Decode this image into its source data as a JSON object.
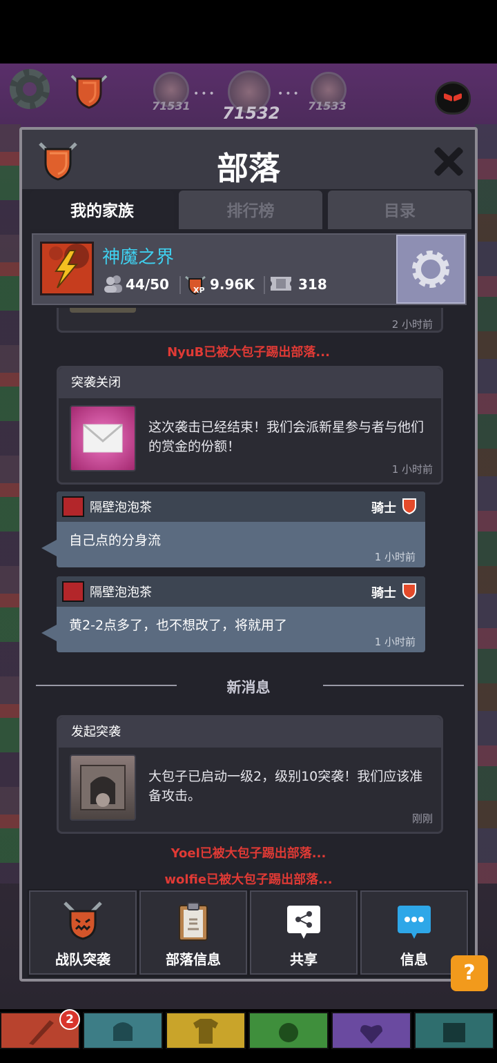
{
  "top_hud": {
    "stages": [
      "71531",
      "71532",
      "71533"
    ]
  },
  "panel": {
    "title": "部落",
    "tabs": [
      {
        "label": "我的家族",
        "active": true
      },
      {
        "label": "排行榜",
        "active": false
      },
      {
        "label": "目录",
        "active": false
      }
    ],
    "clan": {
      "name": "神魔之界",
      "members": "44/50",
      "xp": "9.96K",
      "tickets": "318",
      "xp_badge": "XP"
    }
  },
  "feed": {
    "prev_card_time": "2 小时前",
    "kick_1": "NyuB已被大包子踢出部落...",
    "raid_closed": {
      "title": "突袭关闭",
      "text": "这次袭击已经结束！我们会派新星参与者与他们的赏金的份额！",
      "time": "1 小时前"
    },
    "chat_1": {
      "user": "隔壁泡泡茶",
      "rank": "骑士",
      "message": "自己点的分身流",
      "time": "1 小时前"
    },
    "chat_2": {
      "user": "隔壁泡泡茶",
      "rank": "骑士",
      "message": "黄2-2点多了，也不想改了，将就用了",
      "time": "1 小时前"
    },
    "divider": "新消息",
    "raid_started": {
      "title": "发起突袭",
      "text": "大包子已启动一级2，级别10突袭！我们应该准备攻击。",
      "time": "刚刚"
    },
    "kick_2": "Yoel已被大包子踢出部落...",
    "kick_3": "wolfie已被大包子踢出部落..."
  },
  "bottom_buttons": [
    {
      "label": "战队突袭",
      "icon": "raid-mask-icon"
    },
    {
      "label": "部落信息",
      "icon": "clipboard-icon"
    },
    {
      "label": "共享",
      "icon": "share-icon"
    },
    {
      "label": "信息",
      "icon": "chat-bubble-icon"
    }
  ],
  "help": "?",
  "bottom_tabs": {
    "badge_count": "2",
    "colors": [
      "#b8432e",
      "#3d7d86",
      "#c9a42a",
      "#3f8f3c",
      "#6a4aa0",
      "#2f6e6e"
    ]
  }
}
